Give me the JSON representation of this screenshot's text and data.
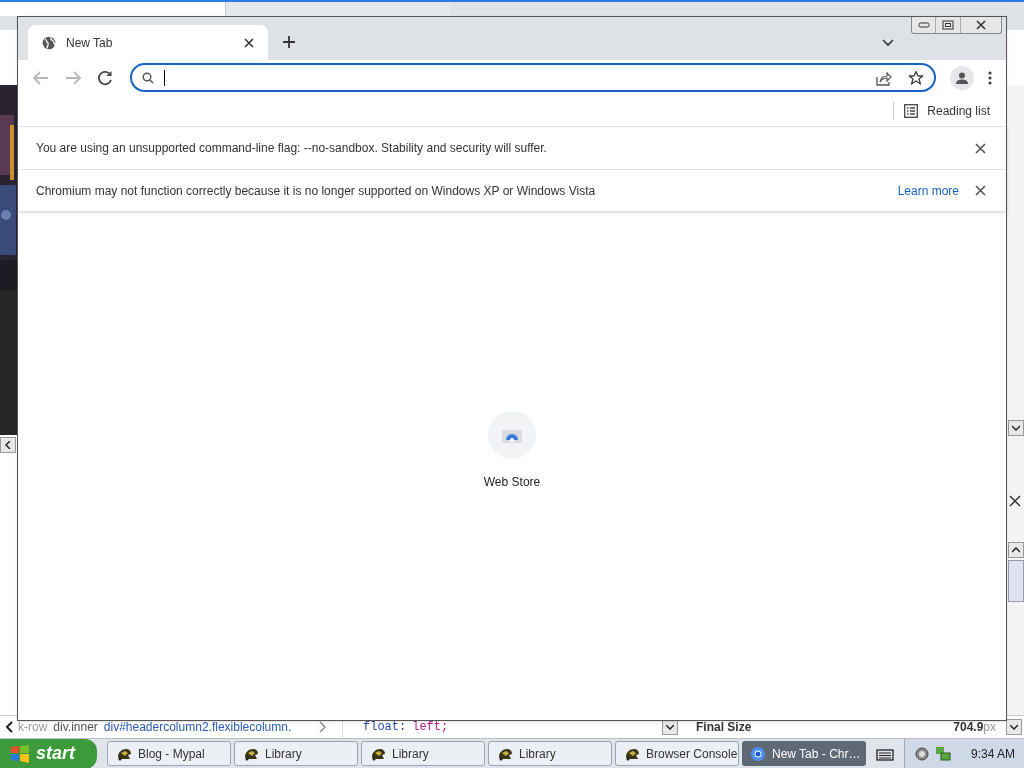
{
  "background": {
    "breadcrumbs": [
      "k-row",
      "div.inner",
      "div#headercolumn2.flexiblecolumn."
    ],
    "css_rule": {
      "property": "float:",
      "value": "left;"
    },
    "final_size": {
      "label": "Final Size",
      "value": "704.9",
      "unit": "px"
    }
  },
  "browser": {
    "tabs": [
      {
        "label": "New Tab",
        "selected": true
      }
    ],
    "bookmarks_bar": {
      "reading_list": "Reading list"
    },
    "infobars": [
      {
        "message": "You are using an unsupported command-line flag: --no-sandbox. Stability and security will suffer."
      },
      {
        "message": "Chromium may not function correctly because it is no longer supported on Windows XP or Windows Vista",
        "link": "Learn more"
      }
    ],
    "shortcuts": [
      {
        "label": "Web Store"
      }
    ]
  },
  "taskbar": {
    "start": "start",
    "buttons": [
      {
        "label": "Blog - Mypal",
        "selected": false,
        "kind": "mypal"
      },
      {
        "label": "Library",
        "selected": false,
        "kind": "mypal"
      },
      {
        "label": "Library",
        "selected": false,
        "kind": "mypal"
      },
      {
        "label": "Library",
        "selected": false,
        "kind": "mypal"
      },
      {
        "label": "Browser Console",
        "selected": false,
        "kind": "mypal"
      },
      {
        "label": "New Tab - Chr…",
        "selected": true,
        "kind": "chromium"
      }
    ],
    "clock": "9:34 AM"
  }
}
